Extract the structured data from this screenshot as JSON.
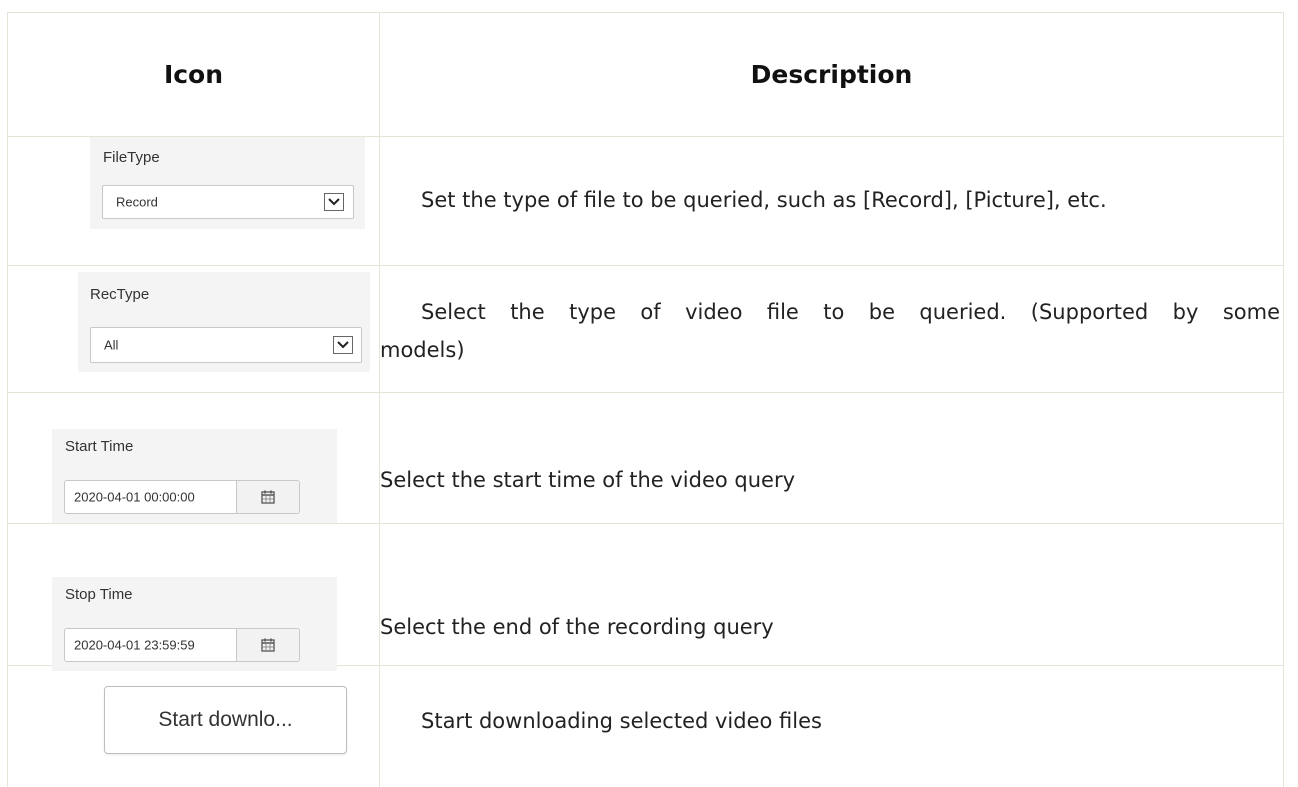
{
  "table": {
    "headers": {
      "icon": "Icon",
      "description": "Description"
    },
    "rows": [
      {
        "icon": {
          "type": "select",
          "label": "FileType",
          "value": "Record",
          "icon_name": "chevron-down-icon"
        },
        "description": "Set the type of file to be queried, such as [Record], [Picture], etc."
      },
      {
        "icon": {
          "type": "select",
          "label": "RecType",
          "value": "All",
          "icon_name": "chevron-down-icon"
        },
        "description_line1": "Select the type of video file to be queried. (Supported by some",
        "description_line2": "models)"
      },
      {
        "icon": {
          "type": "datetime",
          "label": "Start Time",
          "value": "2020-04-01 00:00:00",
          "icon_name": "calendar-icon"
        },
        "description": "Select the start time of the video query"
      },
      {
        "icon": {
          "type": "datetime",
          "label": "Stop Time",
          "value": "2020-04-01 23:59:59",
          "icon_name": "calendar-icon"
        },
        "description": "Select the end of the recording query"
      },
      {
        "icon": {
          "type": "button",
          "label": "Start downlo..."
        },
        "description": "Start downloading selected video files"
      }
    ]
  },
  "colors": {
    "border": "#e6e4d6",
    "panel_bg": "#f4f4f4",
    "text": "#222222"
  }
}
